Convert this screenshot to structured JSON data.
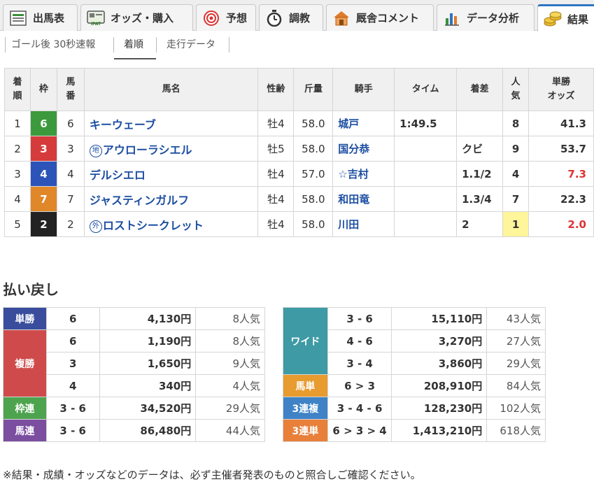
{
  "tabs": [
    {
      "label": "出馬表",
      "icon": "racecard-icon"
    },
    {
      "label": "オッズ・購入",
      "icon": "ipat-icon"
    },
    {
      "label": "予想",
      "icon": "target-icon"
    },
    {
      "label": "調教",
      "icon": "stopwatch-icon"
    },
    {
      "label": "厩舎コメント",
      "icon": "stable-icon"
    },
    {
      "label": "データ分析",
      "icon": "bar-chart-icon"
    },
    {
      "label": "結果",
      "icon": "coins-icon"
    }
  ],
  "subnav": [
    "ゴール後 30秒速報",
    "着順",
    "走行データ"
  ],
  "results": {
    "headers": [
      "着\n順",
      "枠",
      "馬\n番",
      "馬名",
      "性齢",
      "斤量",
      "騎手",
      "タイム",
      "着差",
      "人\n気",
      "単勝\nオッズ"
    ],
    "rows": [
      {
        "pos": "1",
        "waku": "6",
        "waku_color": "#3c9a3c",
        "num": "6",
        "badge": "",
        "name": "キーウェーブ",
        "sexage": "牡4",
        "weight": "58.0",
        "jockey": "城戸",
        "time": "1:49.5",
        "margin": "",
        "pop": "8",
        "odds": "41.3",
        "odds_red": false,
        "pop_highlight": false
      },
      {
        "pos": "2",
        "waku": "3",
        "waku_color": "#d63b3b",
        "num": "3",
        "badge": "地",
        "name": "アウローラシエル",
        "sexage": "牡5",
        "weight": "58.0",
        "jockey": "国分恭",
        "time": "",
        "margin": "クビ",
        "pop": "9",
        "odds": "53.7",
        "odds_red": false,
        "pop_highlight": false
      },
      {
        "pos": "3",
        "waku": "4",
        "waku_color": "#2c54b8",
        "num": "4",
        "badge": "",
        "name": "デルシエロ",
        "sexage": "牡4",
        "weight": "57.0",
        "jockey": "☆吉村",
        "time": "",
        "margin": "1.1/2",
        "pop": "4",
        "odds": "7.3",
        "odds_red": true,
        "pop_highlight": false
      },
      {
        "pos": "4",
        "waku": "7",
        "waku_color": "#e0872a",
        "num": "7",
        "badge": "",
        "name": "ジャスティンガルフ",
        "sexage": "牡4",
        "weight": "58.0",
        "jockey": "和田竜",
        "time": "",
        "margin": "1.3/4",
        "pop": "7",
        "odds": "22.3",
        "odds_red": false,
        "pop_highlight": false
      },
      {
        "pos": "5",
        "waku": "2",
        "waku_color": "#222222",
        "num": "2",
        "badge": "外",
        "name": "ロストシークレット",
        "sexage": "牡4",
        "weight": "58.0",
        "jockey": "川田",
        "time": "",
        "margin": "2",
        "pop": "1",
        "odds": "2.0",
        "odds_red": true,
        "pop_highlight": true
      }
    ]
  },
  "payout_title": "払い戻し",
  "payouts_left": [
    {
      "type": "単勝",
      "color": "#3a4d9c",
      "entries": [
        {
          "comb": "6",
          "amount": "4,130円",
          "ninki": "8人気"
        }
      ]
    },
    {
      "type": "複勝",
      "color": "#cf4b4b",
      "entries": [
        {
          "comb": "6",
          "amount": "1,190円",
          "ninki": "8人気"
        },
        {
          "comb": "3",
          "amount": "1,650円",
          "ninki": "9人気"
        },
        {
          "comb": "4",
          "amount": "340円",
          "ninki": "4人気"
        }
      ]
    },
    {
      "type": "枠連",
      "color": "#4ea44e",
      "entries": [
        {
          "comb": "3 - 6",
          "amount": "34,520円",
          "ninki": "29人気"
        }
      ]
    },
    {
      "type": "馬連",
      "color": "#7b4ea0",
      "entries": [
        {
          "comb": "3 - 6",
          "amount": "86,480円",
          "ninki": "44人気"
        }
      ]
    }
  ],
  "payouts_right": [
    {
      "type": "ワイド",
      "color": "#3e9aa5",
      "entries": [
        {
          "comb": "3 - 6",
          "amount": "15,110円",
          "ninki": "43人気"
        },
        {
          "comb": "4 - 6",
          "amount": "3,270円",
          "ninki": "27人気"
        },
        {
          "comb": "3 - 4",
          "amount": "3,860円",
          "ninki": "29人気"
        }
      ]
    },
    {
      "type": "馬単",
      "color": "#e89b2f",
      "entries": [
        {
          "comb": "6 > 3",
          "amount": "208,910円",
          "ninki": "84人気"
        }
      ]
    },
    {
      "type": "3連複",
      "color": "#3f83c6",
      "entries": [
        {
          "comb": "3 - 4 - 6",
          "amount": "128,230円",
          "ninki": "102人気"
        }
      ]
    },
    {
      "type": "3連単",
      "color": "#e8803a",
      "entries": [
        {
          "comb": "6 > 3 > 4",
          "amount": "1,413,210円",
          "ninki": "618人気"
        }
      ]
    }
  ],
  "note": "※結果・成績・オッズなどのデータは、必ず主催者発表のものと照合しご確認ください。"
}
